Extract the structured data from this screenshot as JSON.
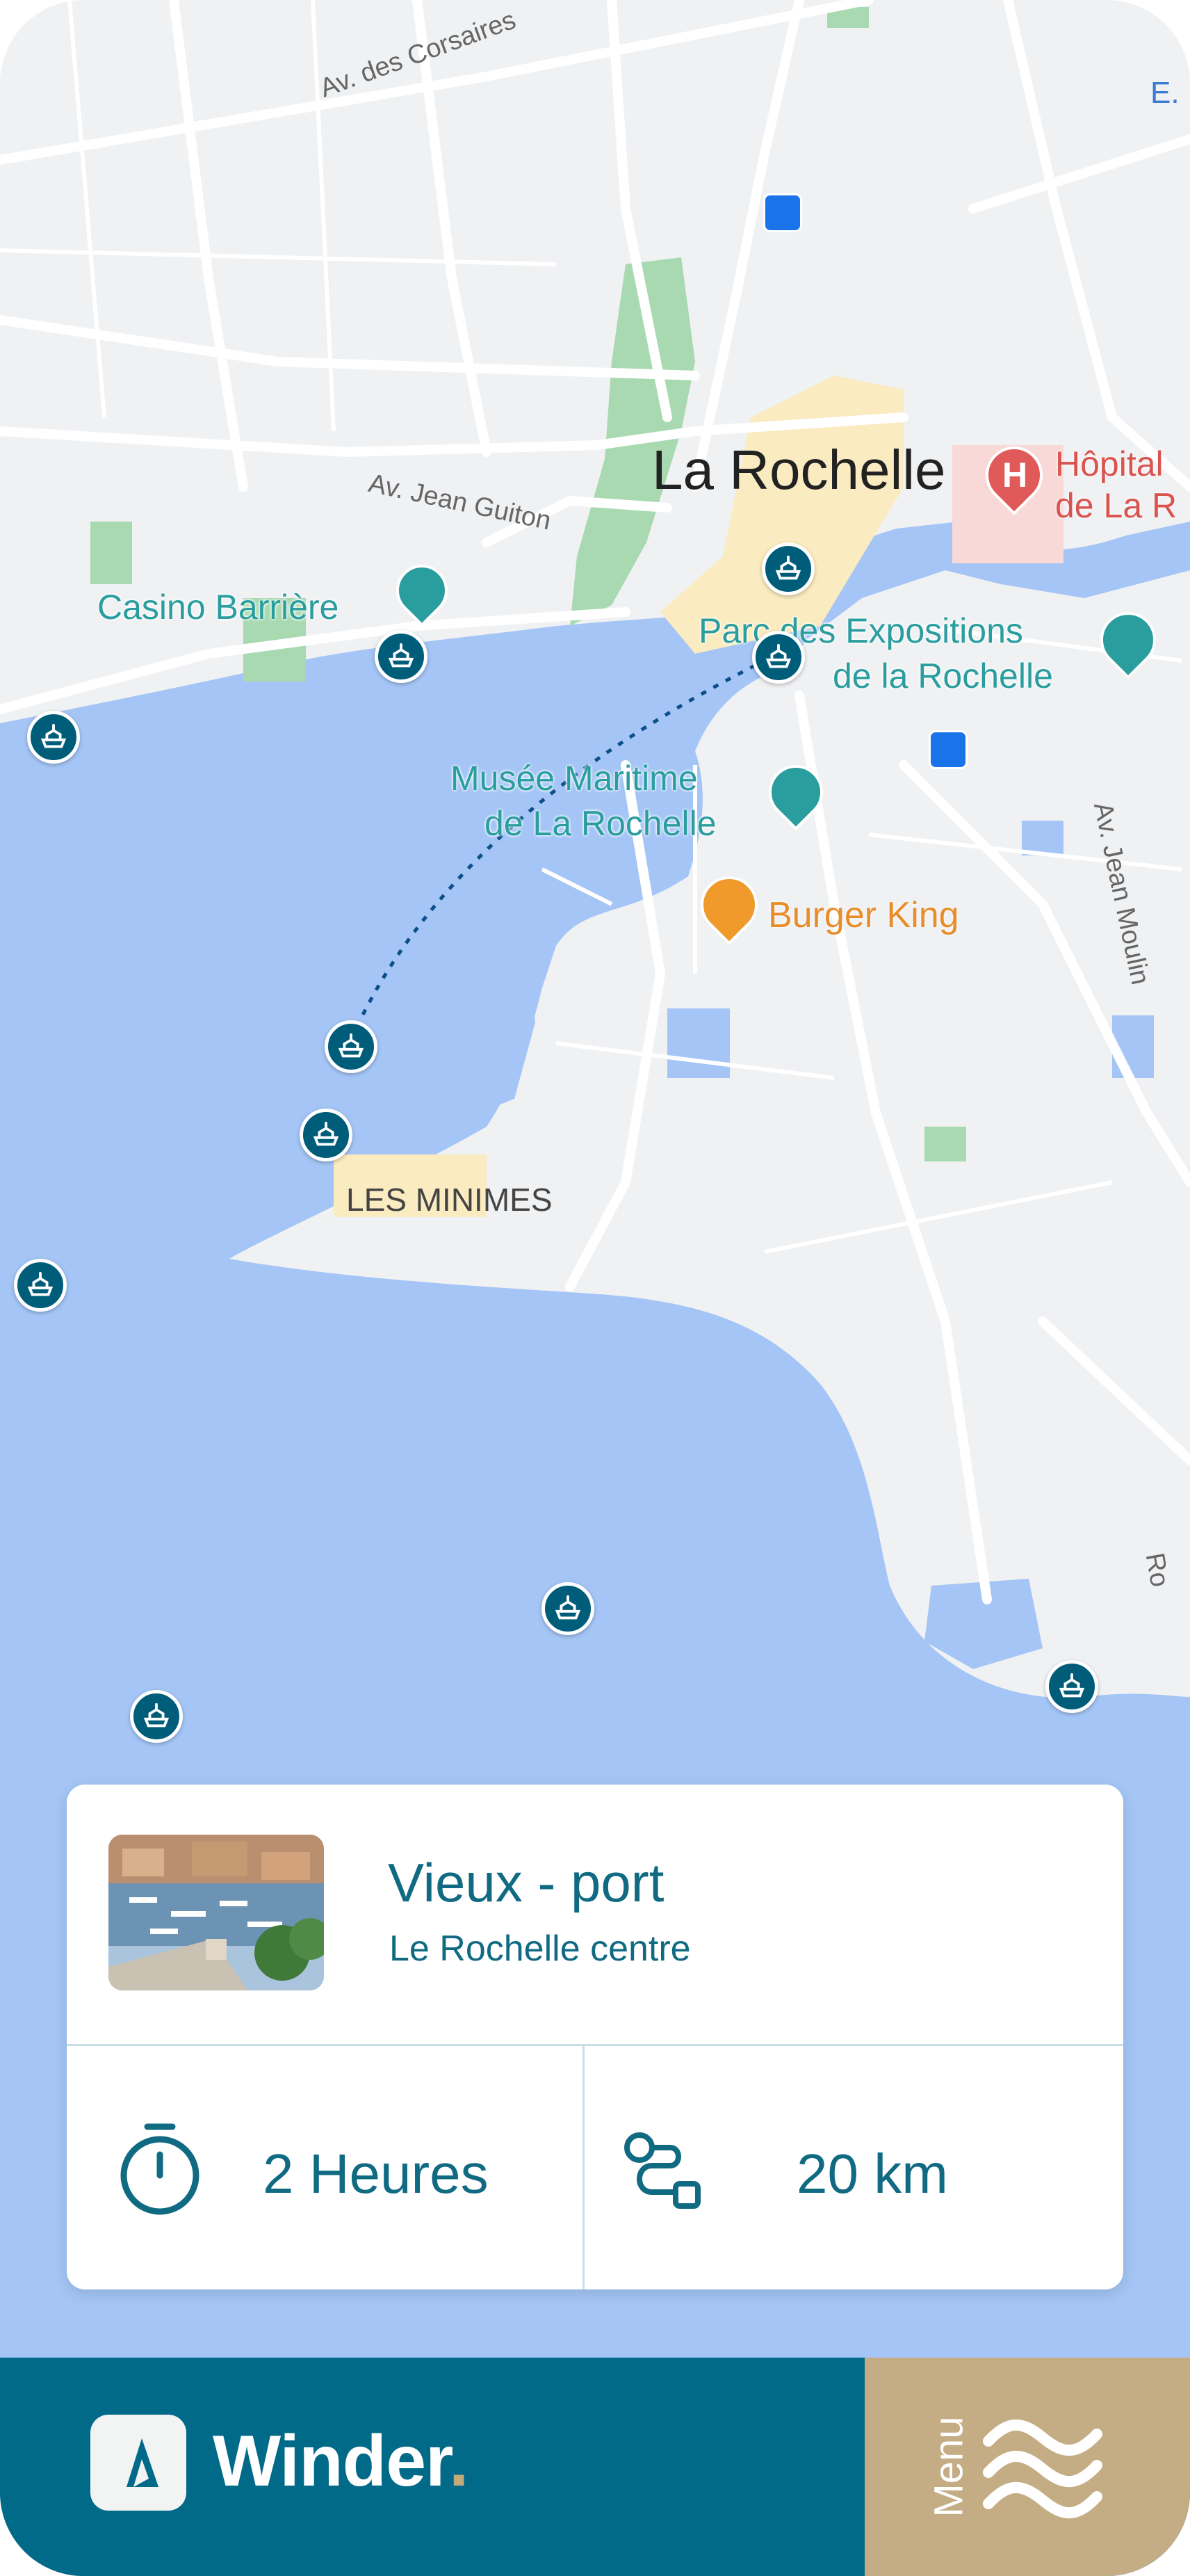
{
  "map": {
    "labels": {
      "city": "La Rochelle",
      "avenue_corsaires": "Av. des Corsaires",
      "avenue_jean_guiton": "Av. Jean Guiton",
      "avenue_jean_moulin": "Av. Jean Moulin",
      "casino": "Casino Barrière",
      "hospital_line1": "Hôpital",
      "hospital_line2": "de La R",
      "expo_line1": "Parc des Expositions",
      "expo_line2": "de la Rochelle",
      "museum_line1": "Musée Maritime",
      "museum_line2": "de La Rochelle",
      "burger_king": "Burger King",
      "les_minimes": "LES MINIMES",
      "edge_top_right": "E.",
      "edge_right": "Ro"
    },
    "colors": {
      "water": "#a4c5f5",
      "land": "#f0f1f3",
      "park": "#a8d9b0",
      "pin": "#005d7a"
    }
  },
  "card": {
    "title": "Vieux - port",
    "subtitle": "Le Rochelle centre",
    "duration": "2 Heures",
    "distance": "20 km"
  },
  "bottom_bar": {
    "brand_name": "Winder",
    "brand_dot": ".",
    "menu_label": "Menu",
    "colors": {
      "bar": "#006a88",
      "menu": "#c4ad85"
    }
  }
}
